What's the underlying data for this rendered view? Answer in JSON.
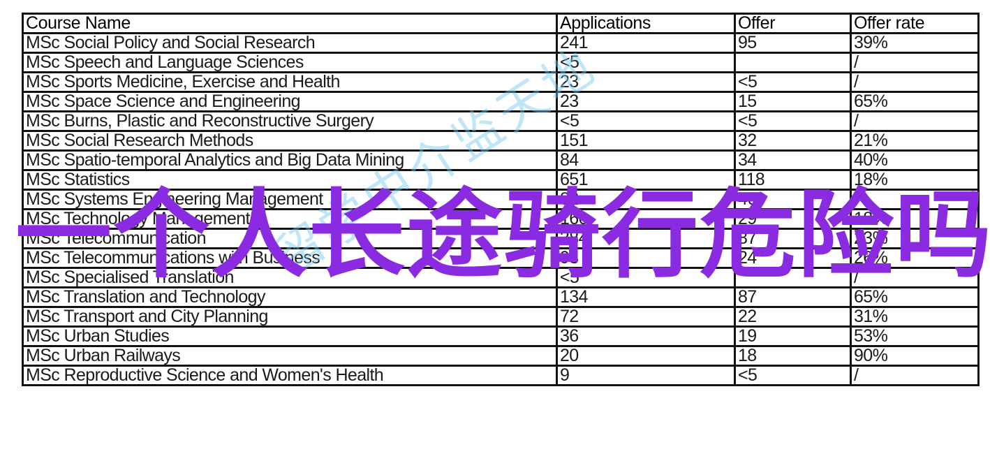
{
  "table": {
    "headers": [
      "Course Name",
      "Applications",
      "Offer",
      "Offer rate"
    ],
    "rows": [
      [
        "MSc Social Policy and Social Research",
        "241",
        "95",
        "39%"
      ],
      [
        "MSc Speech and Language Sciences",
        "<5",
        "",
        "/"
      ],
      [
        "MSc Sports Medicine, Exercise and Health",
        "23",
        "<5",
        "/"
      ],
      [
        "MSc Space Science and Engineering",
        "23",
        "15",
        "65%"
      ],
      [
        "MSc Burns, Plastic and Reconstructive Surgery",
        "<5",
        "<5",
        "/"
      ],
      [
        "MSc Social Research Methods",
        "151",
        "32",
        "21%"
      ],
      [
        "MSc Spatio-temporal Analytics and Big Data Mining",
        "84",
        "34",
        "40%"
      ],
      [
        "MSc Statistics",
        "651",
        "118",
        "18%"
      ],
      [
        "MSc Systems Engineering Management",
        "82",
        "46",
        "/"
      ],
      [
        "MSc Technology Management",
        "160",
        "29",
        "18%"
      ],
      [
        "MSc Telecommunication",
        "384",
        "87",
        "23%"
      ],
      [
        "MSc Telecommunications with Business",
        "93",
        "24",
        "26%"
      ],
      [
        "MSc Specialised Translation",
        "<5",
        "",
        "/"
      ],
      [
        "MSc Translation and Technology",
        "134",
        "87",
        "65%"
      ],
      [
        "MSc Transport and City Planning",
        "72",
        "22",
        "31%"
      ],
      [
        "MSc Urban Studies",
        "36",
        "19",
        "53%"
      ],
      [
        "MSc Urban Railways",
        "20",
        "18",
        "90%"
      ],
      [
        "MSc Reproductive Science and Women's Health",
        "9",
        "<5",
        "/"
      ]
    ]
  },
  "overlay_title": "一个人长途骑行危险吗",
  "watermark": "留学中介监天地",
  "colors": {
    "overlay_title": "#8a2be2",
    "watermark": "#6ec8f0",
    "grid": "#111111"
  }
}
